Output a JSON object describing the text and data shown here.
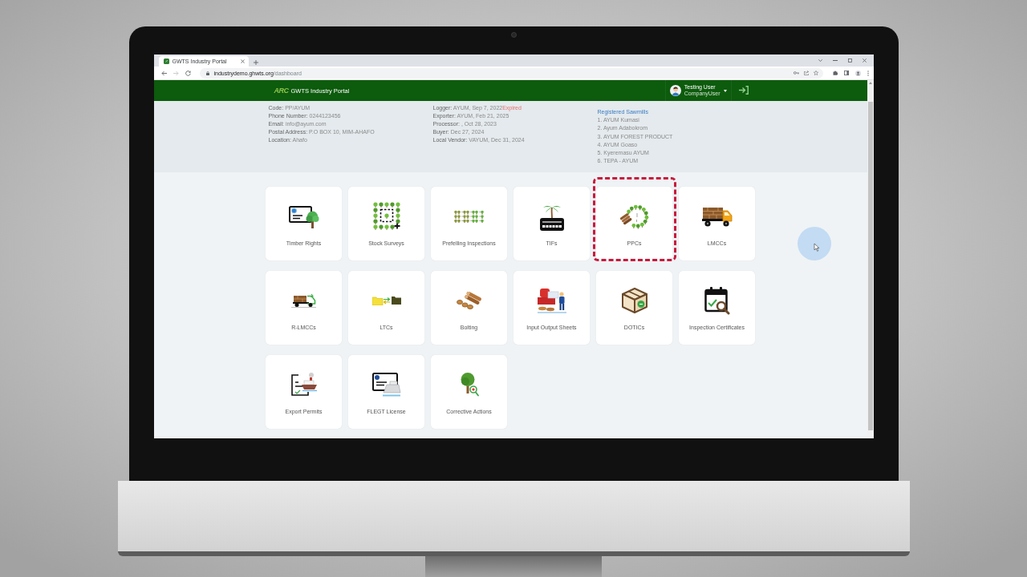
{
  "browser": {
    "tab_title": "GWTS Industry Portal",
    "url": {
      "host": "industrydemo.ghwts.org",
      "path": "/dashboard"
    },
    "forward_enabled": false
  },
  "header": {
    "logo": "ARC",
    "title": "GWTS Industry Portal",
    "user": {
      "name": "Testing User",
      "role": "CompanyUser"
    }
  },
  "company": [
    {
      "label": "Code:",
      "value": "PP/AYUM"
    },
    {
      "label": "Phone Number:",
      "value": "0244123456"
    },
    {
      "label": "Email:",
      "value": "info@ayum.com"
    },
    {
      "label": "Postal Address:",
      "value": "P.O BOX 10, MIM-AHAFO"
    },
    {
      "label": "Location:",
      "value": "Ahafo"
    }
  ],
  "licenses": [
    {
      "label": "Logger:",
      "value": "AYUM, Sep 7, 2022",
      "note": "Expired"
    },
    {
      "label": "Exporter:",
      "value": "AYUM, Feb 21, 2025"
    },
    {
      "label": "Processor:",
      "value": ", Oct 28, 2023"
    },
    {
      "label": "Buyer:",
      "value": "Dec 27, 2024"
    },
    {
      "label": "Local Vendor:",
      "value": "VAYUM, Dec 31, 2024"
    }
  ],
  "sawmills": {
    "title": "Registered Sawmills",
    "items": [
      "1. AYUM Kumasi",
      "2. Ayum Adabokrom",
      "3. AYUM FOREST PRODUCT",
      "4. AYUM Goaso",
      "5. Kyeremasu AYUM",
      "6. TEPA - AYUM"
    ]
  },
  "tiles": [
    {
      "label": "Timber Rights",
      "kind": "rights",
      "highlighted": false
    },
    {
      "label": "Stock Surveys",
      "kind": "survey",
      "highlighted": false
    },
    {
      "label": "Prefelling Inspections",
      "kind": "prefelling",
      "highlighted": false
    },
    {
      "label": "TIFs",
      "kind": "tif",
      "highlighted": false
    },
    {
      "label": "PPCs",
      "kind": "ppc",
      "highlighted": true
    },
    {
      "label": "LMCCs",
      "kind": "lmcc",
      "highlighted": false
    },
    {
      "label": "R-LMCCs",
      "kind": "rlmcc",
      "highlighted": false
    },
    {
      "label": "LTCs",
      "kind": "ltc",
      "highlighted": false
    },
    {
      "label": "Bolting",
      "kind": "bolting",
      "highlighted": false
    },
    {
      "label": "Input Output Sheets",
      "kind": "iosheet",
      "highlighted": false
    },
    {
      "label": "DOTICs",
      "kind": "dotic",
      "highlighted": false
    },
    {
      "label": "Inspection Certificates",
      "kind": "inspection",
      "highlighted": false
    },
    {
      "label": "Export Permits",
      "kind": "export",
      "highlighted": false
    },
    {
      "label": "FLEGT License",
      "kind": "flegt",
      "highlighted": false
    },
    {
      "label": "Corrective Actions",
      "kind": "corrective",
      "highlighted": false
    }
  ]
}
